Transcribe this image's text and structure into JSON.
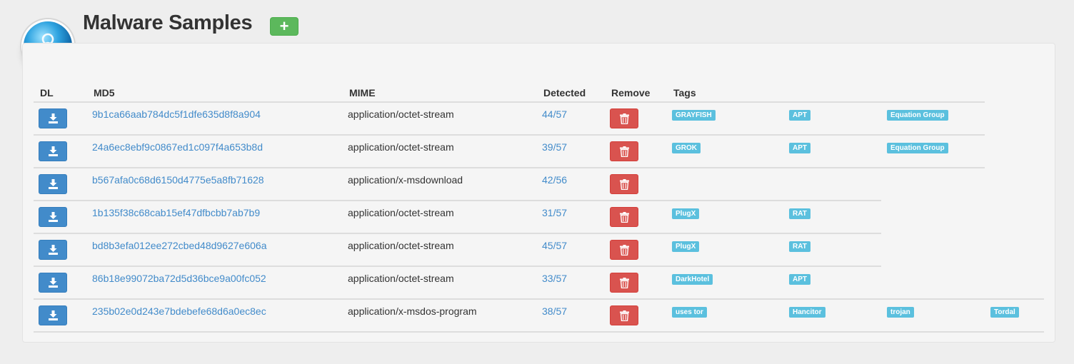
{
  "header": {
    "title": "Malware Samples",
    "add_label": "+"
  },
  "table": {
    "columns": [
      "DL",
      "MD5",
      "MIME",
      "Detected",
      "Remove",
      "Tags"
    ],
    "rows": [
      {
        "md5": "9b1ca66aab784dc5f1dfe635d8f8a904",
        "mime": "application/octet-stream",
        "detected": "44/57",
        "tags": [
          "GRAYFISH",
          "APT",
          "Equation Group"
        ]
      },
      {
        "md5": "24a6ec8ebf9c0867ed1c097f4a653b8d",
        "mime": "application/octet-stream",
        "detected": "39/57",
        "tags": [
          "GROK",
          "APT",
          "Equation Group"
        ]
      },
      {
        "md5": "b567afa0c68d6150d4775e5a8fb71628",
        "mime": "application/x-msdownload",
        "detected": "42/56",
        "tags": []
      },
      {
        "md5": "1b135f38c68cab15ef47dfbcbb7ab7b9",
        "mime": "application/octet-stream",
        "detected": "31/57",
        "tags": [
          "PlugX",
          "RAT"
        ]
      },
      {
        "md5": "bd8b3efa012ee272cbed48d9627e606a",
        "mime": "application/octet-stream",
        "detected": "45/57",
        "tags": [
          "PlugX",
          "RAT"
        ]
      },
      {
        "md5": "86b18e99072ba72d5d36bce9a00fc052",
        "mime": "application/octet-stream",
        "detected": "33/57",
        "tags": [
          "DarkHotel",
          "APT"
        ]
      },
      {
        "md5": "235b02e0d243e7bdebefe68d6a0ec8ec",
        "mime": "application/x-msdos-program",
        "detected": "38/57",
        "tags": [
          "uses tor",
          "Hancitor",
          "trojan",
          "Tordal"
        ]
      }
    ]
  },
  "icons": {
    "logo": "biohazard-icon",
    "download": "download-icon",
    "remove": "trash-icon"
  },
  "colors": {
    "link": "#428bca",
    "download_button": "#428bca",
    "remove_button": "#d9534f",
    "add_button": "#5cb85c",
    "tag": "#5bc0de"
  }
}
